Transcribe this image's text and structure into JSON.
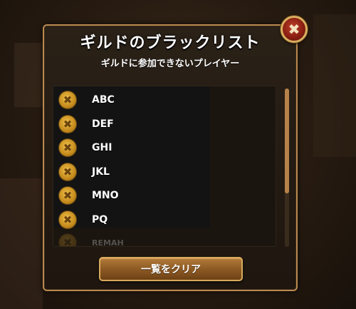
{
  "dialog": {
    "title": "ギルドのブラックリスト",
    "subtitle": "ギルドに参加できないプレイヤー",
    "close_symbol": "✖",
    "remove_symbol": "✖",
    "clear_button_label": "一覧をクリア"
  },
  "blacklist": [
    {
      "name": "ABC"
    },
    {
      "name": "DEF"
    },
    {
      "name": "GHI"
    },
    {
      "name": "JKL"
    },
    {
      "name": "MNO"
    },
    {
      "name": "PQ"
    },
    {
      "name": "REMAH"
    }
  ],
  "colors": {
    "panel_border": "#b9894f",
    "close_button": "#8a1f12",
    "remove_icon": "#f0c048",
    "clear_button": "#8d5a24",
    "scroll_thumb": "#b6824a"
  },
  "icons": {
    "close": "close-icon",
    "remove": "remove-icon"
  },
  "scroll": {
    "visible_fraction": 0.66
  }
}
